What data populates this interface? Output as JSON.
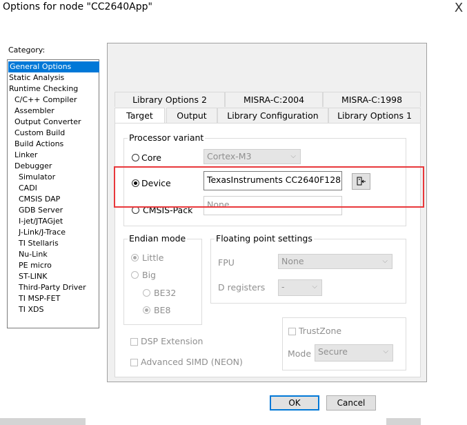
{
  "window": {
    "title": "Options for node \"CC2640App\"",
    "close_glyph": "X"
  },
  "category": {
    "label": "Category:",
    "items": [
      "General Options",
      "Static Analysis",
      "Runtime Checking",
      "C/C++ Compiler",
      "Assembler",
      "Output Converter",
      "Custom Build",
      "Build Actions",
      "Linker",
      "Debugger",
      "Simulator",
      "CADI",
      "CMSIS DAP",
      "GDB Server",
      "I-jet/JTAGjet",
      "J-Link/J-Trace",
      "TI Stellaris",
      "Nu-Link",
      "PE micro",
      "ST-LINK",
      "Third-Party Driver",
      "TI MSP-FET",
      "TI XDS"
    ],
    "selected": "General Options"
  },
  "tabs": {
    "row1": [
      "Library Options 2",
      "MISRA-C:2004",
      "MISRA-C:1998"
    ],
    "row2": [
      "Target",
      "Output",
      "Library Configuration",
      "Library Options 1"
    ],
    "active": "Target"
  },
  "processor": {
    "group_label": "Processor variant",
    "core_label": "Core",
    "core_value": "Cortex-M3",
    "device_label": "Device",
    "device_value": "TexasInstruments CC2640F128",
    "cmsis_label": "CMSIS-Pack",
    "cmsis_value": "None",
    "selected": "Device"
  },
  "endian": {
    "group_label": "Endian mode",
    "little": "Little",
    "big": "Big",
    "be32": "BE32",
    "be8": "BE8"
  },
  "fpu": {
    "group_label": "Floating point settings",
    "fpu_label": "FPU",
    "fpu_value": "None",
    "dreg_label": "D registers",
    "dreg_value": "-"
  },
  "trustzone": {
    "label": "TrustZone",
    "mode_label": "Mode",
    "mode_value": "Secure"
  },
  "extensions": {
    "dsp": "DSP Extension",
    "simd": "Advanced SIMD (NEON)"
  },
  "buttons": {
    "ok": "OK",
    "cancel": "Cancel"
  },
  "colors": {
    "selection": "#0078d7",
    "highlight_box": "#e8373a"
  }
}
